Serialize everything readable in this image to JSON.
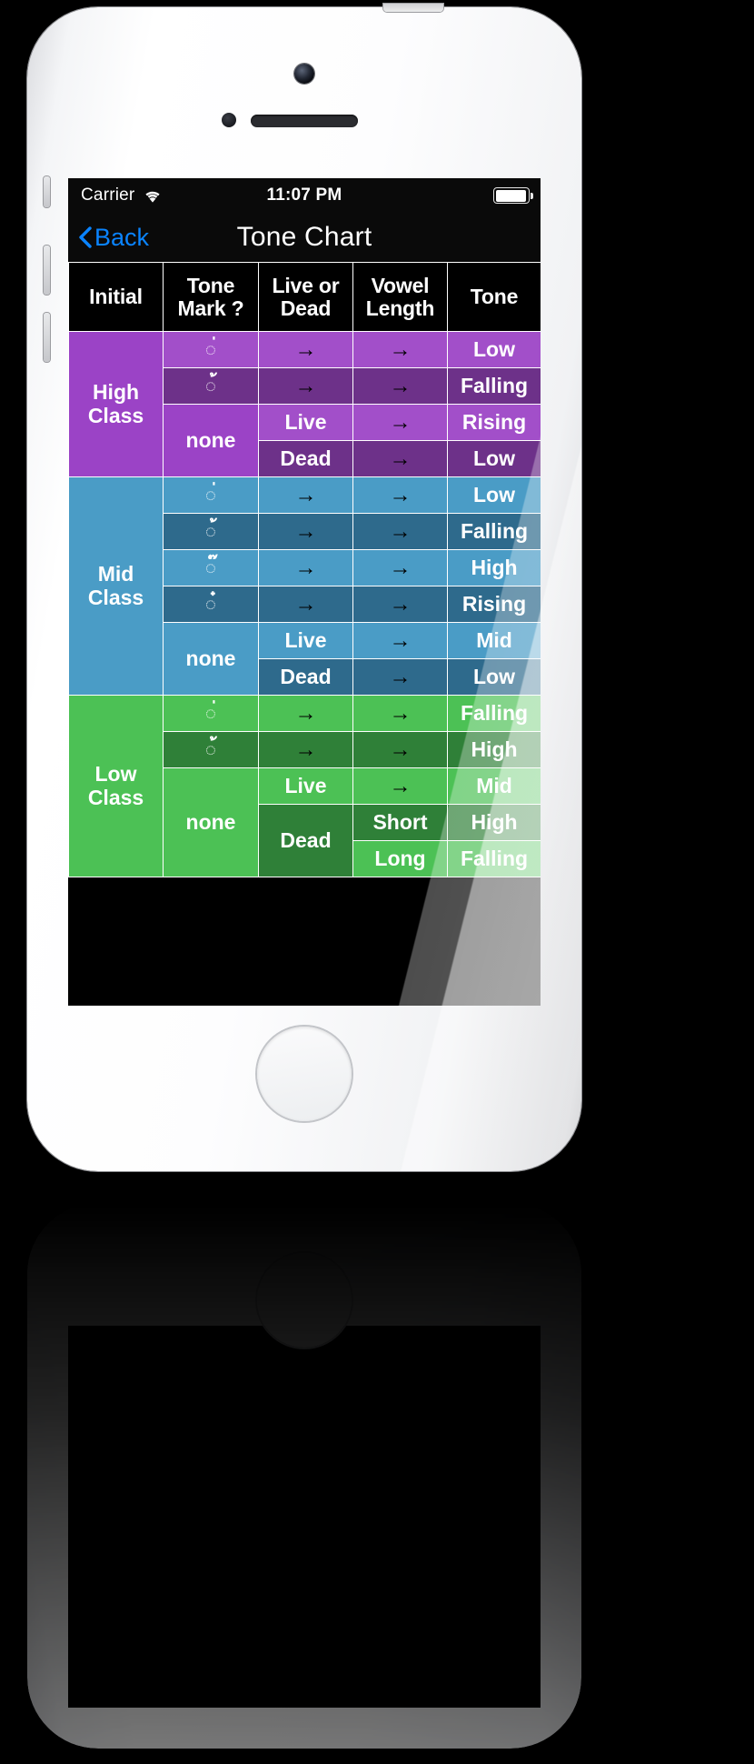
{
  "device": {
    "name": "iphone-5s-white",
    "body_color": "#f4f5f7"
  },
  "status_bar": {
    "carrier": "Carrier",
    "wifi_icon": "wifi-icon",
    "time": "11:07 PM",
    "battery_icon": "battery-full-icon"
  },
  "nav_bar": {
    "back_icon": "chevron-left-icon",
    "back_label": "Back",
    "title": "Tone Chart",
    "accent_color": "#0a84ff"
  },
  "table": {
    "headers": [
      "Initial",
      "Tone Mark ?",
      "Live or Dead",
      "Vowel Length",
      "Tone"
    ],
    "groups": [
      {
        "id": "high-class",
        "class_label": "High Class",
        "color": "#9b43c6",
        "color_alt": "#6d3189",
        "rows": [
          {
            "mark": "่",
            "mark_name": "mai-ek",
            "live_dead": "→",
            "vowel_length": "→",
            "tone": "Low",
            "shade": "a"
          },
          {
            "mark": "้",
            "mark_name": "mai-tho",
            "live_dead": "→",
            "vowel_length": "→",
            "tone": "Falling",
            "shade": "b"
          },
          {
            "mark": "none",
            "mark_name": "no-tone-mark",
            "live_dead": "Live",
            "vowel_length": "→",
            "tone": "Rising",
            "shade": "a"
          },
          {
            "mark": "none",
            "mark_name": "no-tone-mark",
            "live_dead": "Dead",
            "vowel_length": "→",
            "tone": "Low",
            "shade": "b"
          }
        ],
        "none_label": "none"
      },
      {
        "id": "mid-class",
        "class_label": "Mid Class",
        "color": "#4a9cc6",
        "color_alt": "#2e6a8c",
        "rows": [
          {
            "mark": "่",
            "mark_name": "mai-ek",
            "live_dead": "→",
            "vowel_length": "→",
            "tone": "Low",
            "shade": "a"
          },
          {
            "mark": "้",
            "mark_name": "mai-tho",
            "live_dead": "→",
            "vowel_length": "→",
            "tone": "Falling",
            "shade": "b"
          },
          {
            "mark": "๊",
            "mark_name": "mai-tri",
            "live_dead": "→",
            "vowel_length": "→",
            "tone": "High",
            "shade": "a"
          },
          {
            "mark": "๋",
            "mark_name": "mai-chattawa",
            "live_dead": "→",
            "vowel_length": "→",
            "tone": "Rising",
            "shade": "b"
          },
          {
            "mark": "none",
            "mark_name": "no-tone-mark",
            "live_dead": "Live",
            "vowel_length": "→",
            "tone": "Mid",
            "shade": "a"
          },
          {
            "mark": "none",
            "mark_name": "no-tone-mark",
            "live_dead": "Dead",
            "vowel_length": "→",
            "tone": "Low",
            "shade": "b"
          }
        ],
        "none_label": "none"
      },
      {
        "id": "low-class",
        "class_label": "Low Class",
        "color": "#4cc155",
        "color_alt": "#2f8038",
        "rows": [
          {
            "mark": "่",
            "mark_name": "mai-ek",
            "live_dead": "→",
            "vowel_length": "→",
            "tone": "Falling",
            "shade": "a"
          },
          {
            "mark": "้",
            "mark_name": "mai-tho",
            "live_dead": "→",
            "vowel_length": "→",
            "tone": "High",
            "shade": "b"
          },
          {
            "mark": "none",
            "mark_name": "no-tone-mark",
            "live_dead": "Live",
            "vowel_length": "→",
            "tone": "Mid",
            "shade": "a"
          },
          {
            "mark": "none",
            "mark_name": "no-tone-mark",
            "live_dead": "Dead",
            "vowel_length": "Short",
            "tone": "High",
            "shade": "b"
          },
          {
            "mark": "none",
            "mark_name": "no-tone-mark",
            "live_dead": "Dead",
            "vowel_length": "Long",
            "tone": "Falling",
            "shade": "a"
          }
        ],
        "none_label": "none"
      }
    ]
  },
  "labels": {
    "high_class_l1": "High",
    "high_class_l2": "Class",
    "mid_class_l1": "Mid",
    "mid_class_l2": "Class",
    "low_class_l1": "Low",
    "low_class_l2": "Class",
    "none": "none",
    "live": "Live",
    "dead": "Dead",
    "short": "Short",
    "long": "Long",
    "arrow": "→"
  },
  "tones": {
    "h_mark1": "Low",
    "h_mark2": "Falling",
    "h_live": "Rising",
    "h_dead": "Low",
    "m_mark1": "Low",
    "m_mark2": "Falling",
    "m_mark3": "High",
    "m_mark4": "Rising",
    "m_live": "Mid",
    "m_dead": "Low",
    "l_mark1": "Falling",
    "l_mark2": "High",
    "l_live": "Mid",
    "l_dead_short": "High",
    "l_dead_long": "Falling"
  },
  "marks": {
    "mai_ek": "่",
    "mai_tho": "้",
    "mai_tri": "๊",
    "mai_chattawa": "๋",
    "dotted_circle": "◌"
  },
  "headers": {
    "h0": "Initial",
    "h1a": "Tone",
    "h1b": "Mark ?",
    "h2a": "Live or",
    "h2b": "Dead",
    "h3a": "Vowel",
    "h3b": "Length",
    "h4": "Tone"
  }
}
